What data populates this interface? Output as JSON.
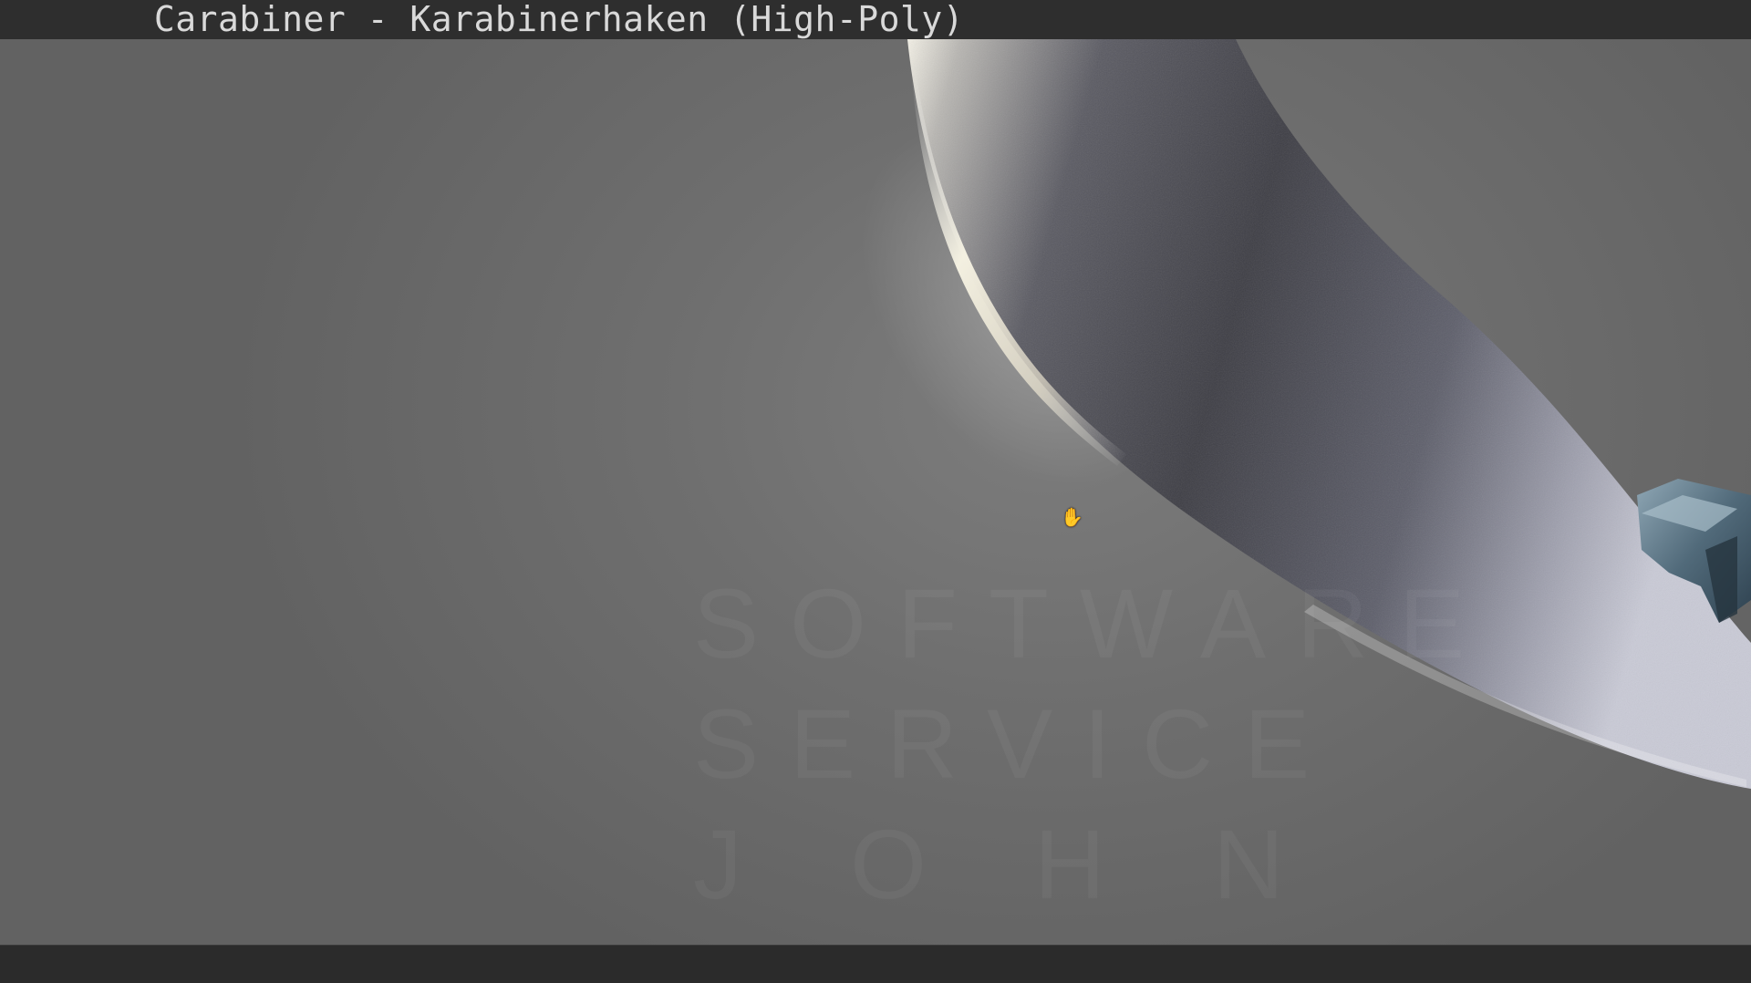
{
  "window": {
    "title": "Carabiner - Karabinerhaken (High-Poly)"
  },
  "viewport": {
    "watermark_lines": [
      "SOFTWARE",
      "SERVICE",
      "JOHN"
    ],
    "cursor_icon": "hand-grab-icon"
  },
  "colors": {
    "title_bar": "#2e2e2e",
    "background": "#6e6e6e",
    "status_bar": "#2b2b2b"
  }
}
